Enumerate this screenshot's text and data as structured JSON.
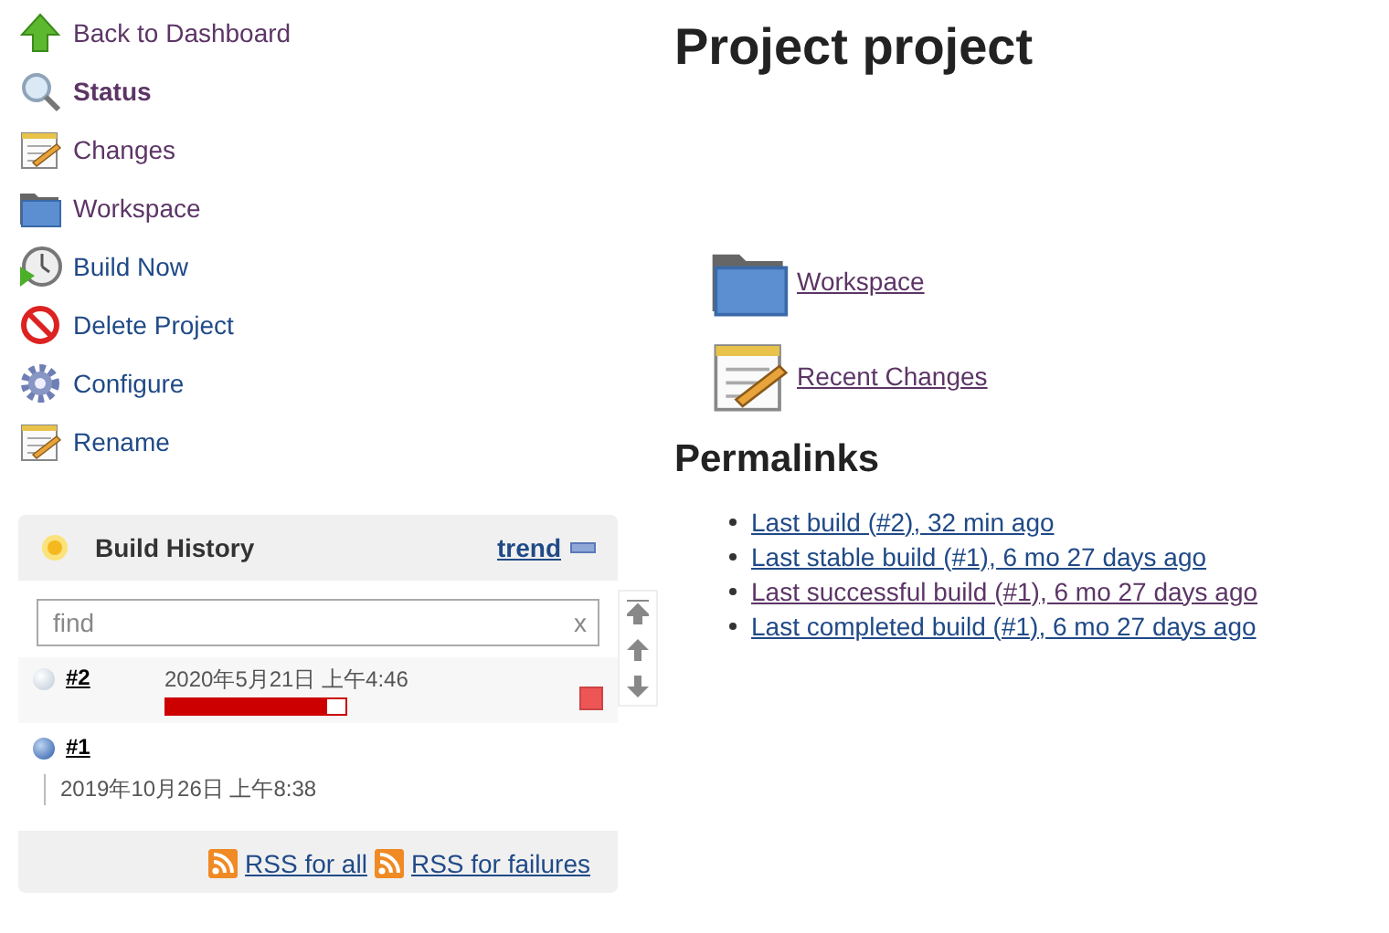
{
  "sidebar": {
    "items": [
      {
        "label": "Back to Dashboard",
        "kind": "up",
        "selected": false,
        "visited": true
      },
      {
        "label": "Status",
        "kind": "search",
        "selected": true,
        "visited": true
      },
      {
        "label": "Changes",
        "kind": "notepad",
        "selected": false,
        "visited": true
      },
      {
        "label": "Workspace",
        "kind": "folder",
        "selected": false,
        "visited": true
      },
      {
        "label": "Build Now",
        "kind": "clock",
        "selected": false,
        "visited": false
      },
      {
        "label": "Delete Project",
        "kind": "forbidden",
        "selected": false,
        "visited": false
      },
      {
        "label": "Configure",
        "kind": "gear",
        "selected": false,
        "visited": false
      },
      {
        "label": "Rename",
        "kind": "notepad",
        "selected": false,
        "visited": false
      }
    ]
  },
  "build_history": {
    "title": "Build History",
    "trend": "trend",
    "search": {
      "placeholder": "find",
      "clear": "x"
    },
    "builds": [
      {
        "number": "#2",
        "time": "2020年5月21日 上午4:46",
        "kind": "running",
        "level": 0.9
      },
      {
        "number": "#1",
        "time": "2019年10月26日 上午8:38",
        "kind": "success"
      }
    ],
    "rss": [
      {
        "label": "RSS for all"
      },
      {
        "label": "RSS for failures"
      }
    ]
  },
  "main": {
    "title": "Project project",
    "links": [
      {
        "label": "Workspace",
        "kind": "folder",
        "visited": true
      },
      {
        "label": "Recent Changes",
        "kind": "notepad",
        "visited": true
      }
    ],
    "permalinks": {
      "title": "Permalinks",
      "items": [
        {
          "label": "Last build (#2), 32 min ago",
          "visited": false
        },
        {
          "label": "Last stable build (#1), 6 mo 27 days ago",
          "visited": false
        },
        {
          "label": "Last successful build (#1), 6 mo 27 days ago",
          "visited": true
        },
        {
          "label": "Last completed build (#1), 6 mo 27 days ago",
          "visited": false
        }
      ]
    }
  }
}
